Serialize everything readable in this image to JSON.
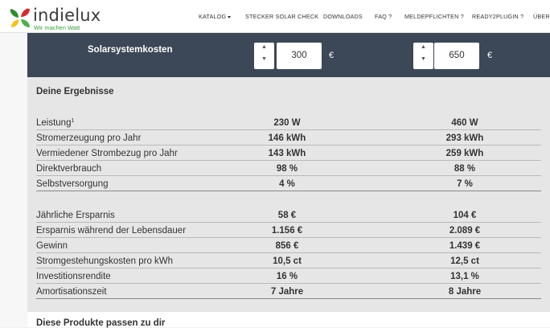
{
  "header": {
    "brand": "indielux",
    "tagline": "Wir machen Watt",
    "nav": [
      {
        "label": "KATALOG",
        "dropdown": true
      },
      {
        "label": "STECKER SOLAR CHECK"
      },
      {
        "label": "DOWNLOADS"
      },
      {
        "label": "FAQ ?"
      },
      {
        "label": "MELDEPFLICHTEN ?"
      },
      {
        "label": "READY2PLUGIN ?"
      },
      {
        "label": "ÜBER"
      }
    ]
  },
  "costs": {
    "label": "Solarsystemkosten",
    "currency": "€",
    "left_value": "300",
    "right_value": "650"
  },
  "results": {
    "title": "Deine Ergebnisse",
    "group1": [
      {
        "label": "Leistung",
        "footnote": "1",
        "v1": "230 W",
        "v2": "460 W"
      },
      {
        "label": "Stromerzeugung pro Jahr",
        "v1": "146 kWh",
        "v2": "293 kWh"
      },
      {
        "label": "Vermiedener Strombezug pro Jahr",
        "v1": "143 kWh",
        "v2": "259 kWh"
      },
      {
        "label": "Direktverbrauch",
        "v1": "98 %",
        "v2": "88 %"
      },
      {
        "label": "Selbstversorgung",
        "v1": "4 %",
        "v2": "7 %"
      }
    ],
    "group2": [
      {
        "label": "Jährliche Ersparnis",
        "v1": "58 €",
        "v2": "104 €"
      },
      {
        "label": "Ersparnis während der Lebensdauer",
        "v1": "1.156 €",
        "v2": "2.089 €"
      },
      {
        "label": "Gewinn",
        "v1": "856 €",
        "v2": "1.439 €"
      },
      {
        "label": "Stromgestehungskosten pro kWh",
        "v1": "10,5 ct",
        "v2": "12,5 ct"
      },
      {
        "label": "Investitionsrendite",
        "v1": "16 %",
        "v2": "13,1 %"
      },
      {
        "label": "Amortisationszeit",
        "v1": "7 Jahre",
        "v2": "8 Jahre"
      }
    ]
  },
  "products": {
    "title": "Diese Produkte passen zu dir"
  },
  "colors": {
    "accent_dark": "#3c4757",
    "brand_green": "#3b9b3b",
    "brand_red": "#d32f2f",
    "brand_yellow": "#f2c21b"
  }
}
